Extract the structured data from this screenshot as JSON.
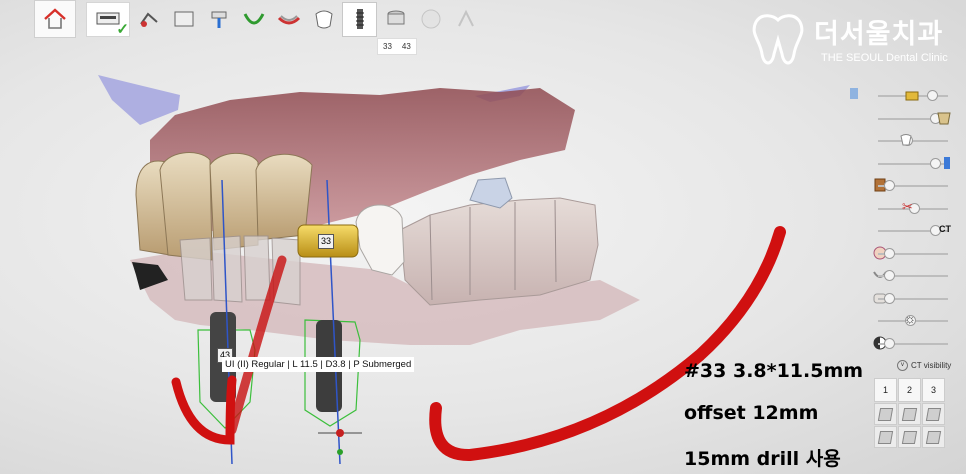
{
  "toolbar": {
    "tools": [
      {
        "name": "home-icon",
        "state": "normal"
      },
      {
        "name": "ct-scan-icon",
        "state": "done"
      },
      {
        "name": "segmentation-icon",
        "state": "normal"
      },
      {
        "name": "panoramic-icon",
        "state": "normal"
      },
      {
        "name": "nerve-canal-icon",
        "state": "normal"
      },
      {
        "name": "arch-icon",
        "state": "normal"
      },
      {
        "name": "model-align-icon",
        "state": "normal"
      },
      {
        "name": "crown-icon",
        "state": "normal"
      },
      {
        "name": "implant-icon",
        "state": "active"
      },
      {
        "name": "sleeve-icon",
        "state": "normal"
      },
      {
        "name": "guide-icon",
        "state": "dim"
      },
      {
        "name": "export-icon",
        "state": "dim"
      }
    ],
    "implant_tabs": [
      "33",
      "43"
    ]
  },
  "logo": {
    "korean": "더서울치과",
    "english": "THE SEOUL Dental Clinic"
  },
  "labels": {
    "tooth_33": "33",
    "tooth_43": "43",
    "implant_info": "UI (II) Regular | L 11.5 | D3.8 | P Submerged"
  },
  "notes": {
    "line1": "#33 3.8*11.5mm",
    "line2": "offset 12mm",
    "line3": "15mm drill 사용"
  },
  "panel": {
    "ct_label": "CT",
    "ct_visibility": "CT visibility",
    "sliders": [
      {
        "name": "implant-slider",
        "value": 0.8
      },
      {
        "name": "crown-slider",
        "value": 0.85
      },
      {
        "name": "tooth-slider",
        "value": 0.4
      },
      {
        "name": "canal-slider",
        "value": 0.85
      },
      {
        "name": "sleeve-slider",
        "value": 0.1
      },
      {
        "name": "cut-slider",
        "value": 0.5
      },
      {
        "name": "ct-slider",
        "value": 0.85
      },
      {
        "name": "face-slider",
        "value": 0.1
      },
      {
        "name": "arch-slider",
        "value": 0.1
      },
      {
        "name": "model-slider",
        "value": 0.1
      },
      {
        "name": "brightness-slider",
        "value": 0.45
      },
      {
        "name": "contrast-slider",
        "value": 0.1
      }
    ],
    "view_buttons": [
      "1",
      "2",
      "3"
    ]
  },
  "colors": {
    "accent_red": "#d01010",
    "gold": "#e9c23a",
    "gum": "#b9707a",
    "check": "#3aa935"
  }
}
